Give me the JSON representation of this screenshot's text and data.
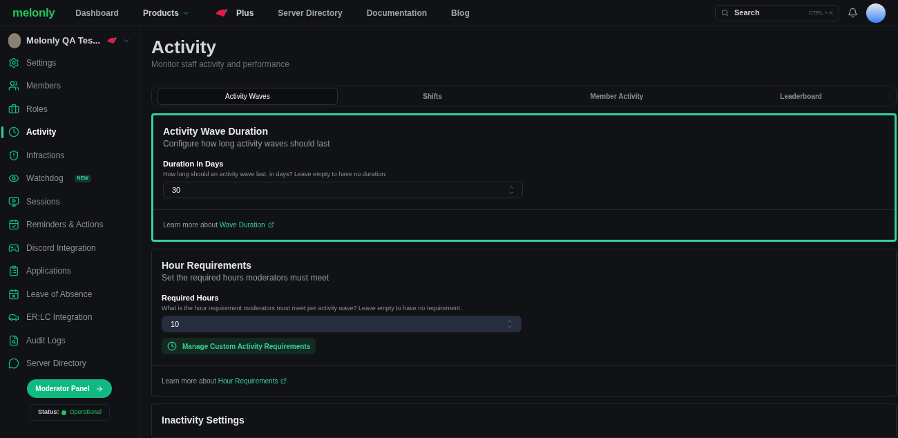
{
  "topbar": {
    "logo": "melonly",
    "nav": [
      {
        "label": "Dashboard",
        "kind": "link"
      },
      {
        "label": "Products",
        "kind": "dropdown"
      },
      {
        "label": "Plus",
        "kind": "plus"
      },
      {
        "label": "Server Directory",
        "kind": "link"
      },
      {
        "label": "Documentation",
        "kind": "link"
      },
      {
        "label": "Blog",
        "kind": "link"
      }
    ],
    "search": {
      "placeholder": "Search",
      "shortcut": "CTRL + K"
    }
  },
  "sidebar": {
    "server": "Melonly QA Tes...",
    "items": [
      {
        "label": "Settings",
        "selected": false
      },
      {
        "label": "Members",
        "selected": false
      },
      {
        "label": "Roles",
        "selected": false
      },
      {
        "label": "Activity",
        "selected": true
      },
      {
        "label": "Infractions",
        "selected": false
      },
      {
        "label": "Watchdog",
        "selected": false,
        "badge": "NEW"
      },
      {
        "label": "Sessions",
        "selected": false
      },
      {
        "label": "Reminders & Actions",
        "selected": false
      },
      {
        "label": "Discord Integration",
        "selected": false
      },
      {
        "label": "Applications",
        "selected": false
      },
      {
        "label": "Leave of Absence",
        "selected": false
      },
      {
        "label": "ER:LC Integration",
        "selected": false
      },
      {
        "label": "Audit Logs",
        "selected": false
      },
      {
        "label": "Server Directory",
        "selected": false
      }
    ],
    "moderator_button": "Moderator Panel",
    "status": {
      "label": "Status:",
      "value": "Operational",
      "color": "#22c55e"
    }
  },
  "page": {
    "title": "Activity",
    "subtitle": "Monitor staff activity and performance",
    "tabs": [
      {
        "label": "Activity Waves",
        "selected": true
      },
      {
        "label": "Shifts",
        "selected": false
      },
      {
        "label": "Member Activity",
        "selected": false
      },
      {
        "label": "Leaderboard",
        "selected": false
      }
    ],
    "cards": [
      {
        "title": "Activity Wave Duration",
        "subtitle": "Configure how long activity waves should last",
        "highlighted": true,
        "field_label": "Duration in Days",
        "field_hint": "How long should an activity wave last, in days? Leave empty to have no duration.",
        "value": "30",
        "filled": false,
        "learn_prefix": "Learn more about",
        "learn_link": "Wave Duration"
      },
      {
        "title": "Hour Requirements",
        "subtitle": "Set the required hours moderators must meet",
        "highlighted": false,
        "field_label": "Required Hours",
        "field_hint": "What is the hour requirement moderators must meet per activity wave? Leave empty to have no requirement.",
        "value": "10",
        "filled": true,
        "action": "Manage Custom Activity Requirements",
        "learn_prefix": "Learn more about",
        "learn_link": "Hour Requirements"
      },
      {
        "title": "Inactivity Settings",
        "highlighted": false
      }
    ]
  }
}
